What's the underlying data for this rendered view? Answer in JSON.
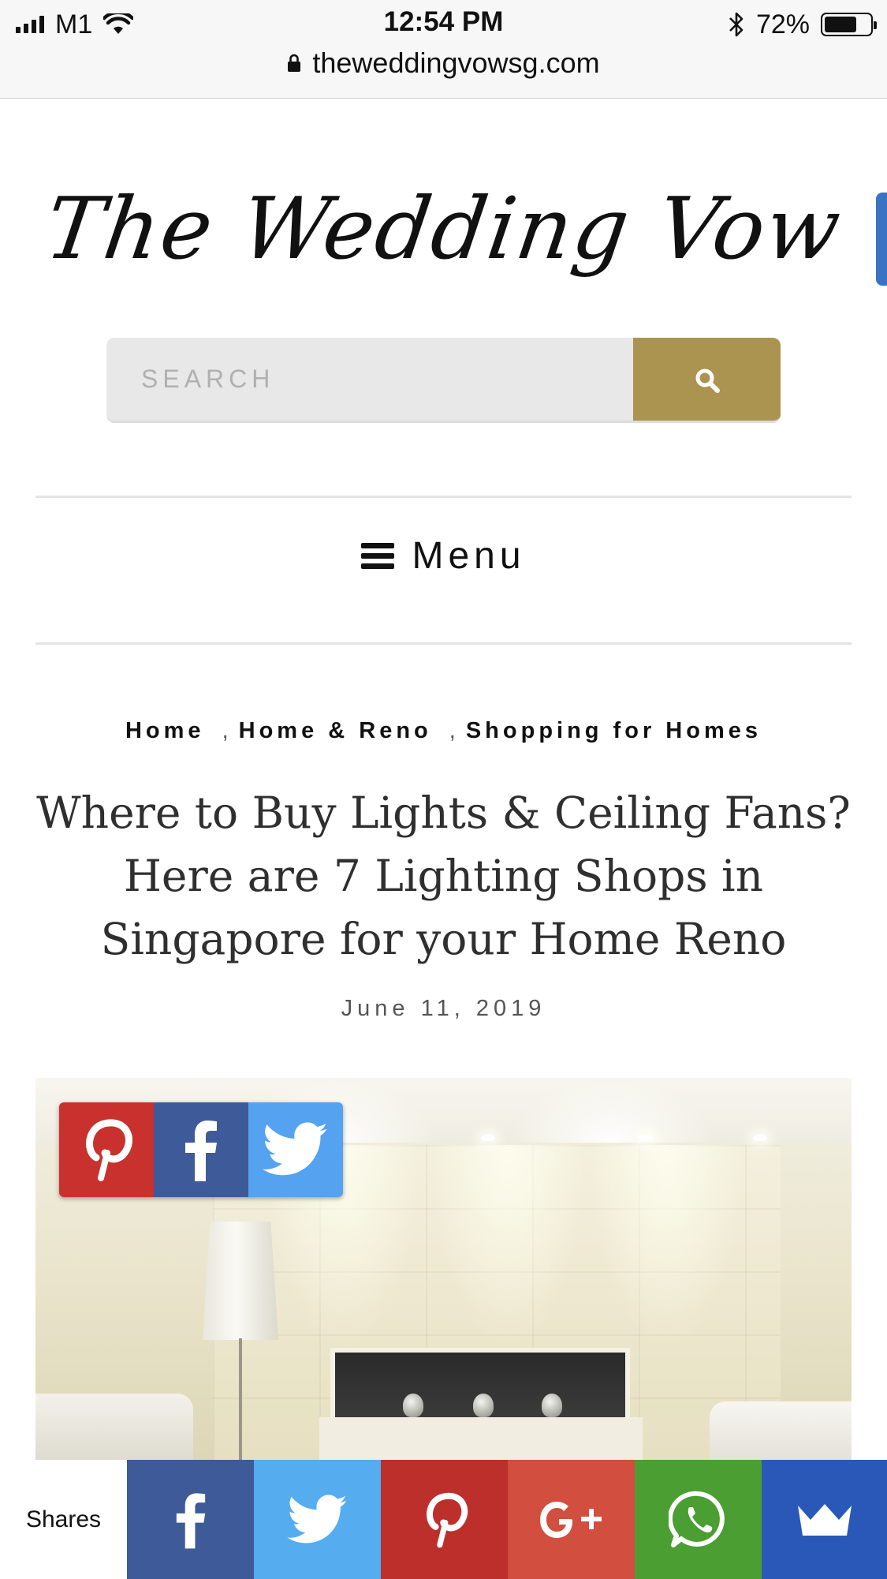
{
  "status_bar": {
    "carrier": "M1",
    "time": "12:54 PM",
    "battery_percent": "72%",
    "battery_level": 0.72,
    "url": "theweddingvowsg.com"
  },
  "site": {
    "logo_text": "The Wedding Vow"
  },
  "search": {
    "placeholder": "SEARCH",
    "value": ""
  },
  "nav": {
    "menu_label": "Menu"
  },
  "breadcrumb": {
    "items": [
      "Home",
      "Home & Reno",
      "Shopping for Homes"
    ],
    "separator": ","
  },
  "article": {
    "title": "Where to Buy Lights & Ceiling Fans? Here are 7 Lighting Shops in Singapore for your Home Reno",
    "date": "June 11, 2019"
  },
  "image_share": {
    "buttons": [
      "pinterest-icon",
      "facebook-icon",
      "twitter-icon"
    ]
  },
  "share_bar": {
    "label": "Shares",
    "buttons": [
      {
        "icon": "facebook-icon",
        "color": "#3f5a99"
      },
      {
        "icon": "twitter-icon",
        "color": "#55acee"
      },
      {
        "icon": "pinterest-icon",
        "color": "#bd2f2b"
      },
      {
        "icon": "google-plus-icon",
        "color": "#d24e3e"
      },
      {
        "icon": "whatsapp-icon",
        "color": "#4a9e32"
      },
      {
        "icon": "sumo-crown-icon",
        "color": "#2a58b8"
      }
    ]
  },
  "colors": {
    "search_button": "#ab944f",
    "side_tab": "#3b73c4"
  }
}
